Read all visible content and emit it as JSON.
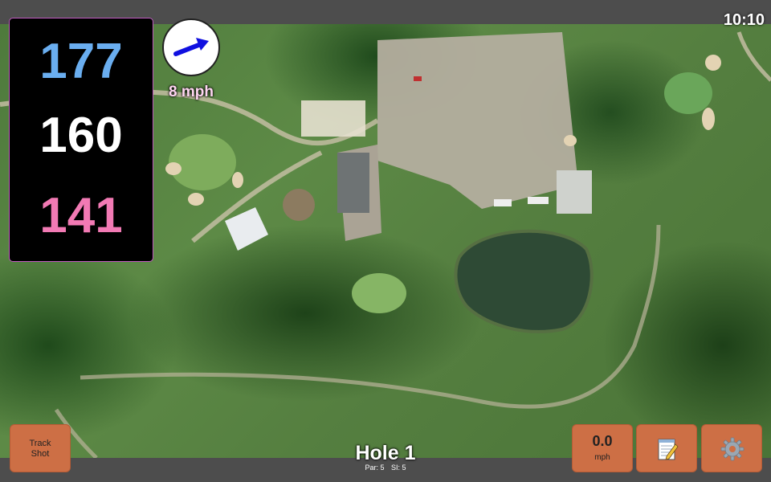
{
  "status": {
    "time": "10:10"
  },
  "distances": {
    "back": "177",
    "center": "160",
    "front": "141"
  },
  "colors": {
    "back": "#6aaef0",
    "center": "#ffffff",
    "front": "#f27ab4",
    "button": "#cd6f45"
  },
  "wind": {
    "speed_label": "8 mph",
    "direction_icon": "arrow-east-northeast"
  },
  "buttons": {
    "track_shot_line1": "Track",
    "track_shot_line2": "Shot",
    "speed_value": "0.0",
    "speed_unit": "mph",
    "notes_icon": "notepad-icon",
    "settings_icon": "gear-icon"
  },
  "hole": {
    "title": "Hole 1",
    "par": "Par: 5",
    "si": "SI: 5"
  }
}
